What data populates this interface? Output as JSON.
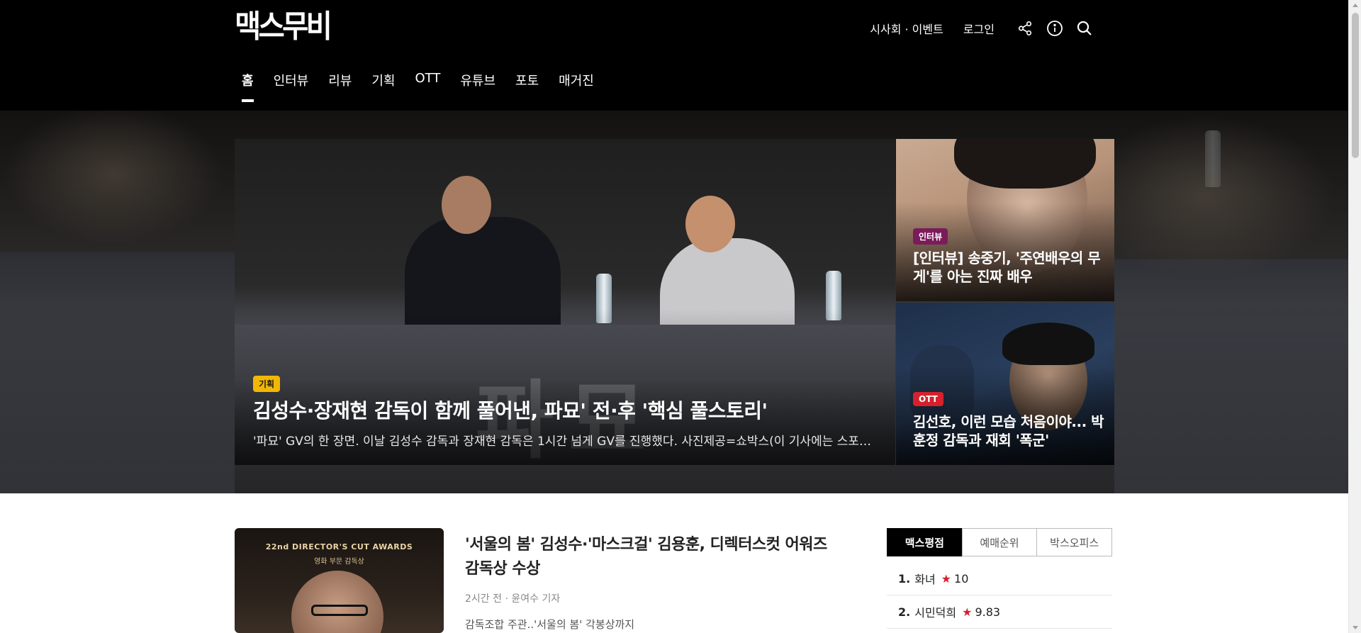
{
  "header": {
    "logo": "맥스무비",
    "util_links": [
      "시사회 · 이벤트",
      "로그인"
    ],
    "icons": [
      "share-icon",
      "info-icon",
      "search-icon"
    ],
    "nav": [
      "홈",
      "인터뷰",
      "리뷰",
      "기획",
      "OTT",
      "유튜브",
      "포토",
      "매거진"
    ],
    "active_nav": "홈"
  },
  "hero": {
    "main": {
      "tag": "기획",
      "title": "김성수·장재현 감독이 함께 풀어낸, 파묘' 전·후 '핵심 풀스토리'",
      "description": "'파묘' GV의 한 장면. 이날 김성수 감독과 장재현 감독은 1시간 넘게 GV를 진행했다. 사진제공=쇼박스(이 기사에는 스포일러가 포함되어 있습니다)",
      "image_text": "파묘"
    },
    "side": [
      {
        "tag": "인터뷰",
        "title": "[인터뷰] 송중기, '주연배우의 무게'를 아는 진짜 배우"
      },
      {
        "tag": "OTT",
        "title": "김선호, 이런 모습 처음이야... 박훈정 감독과 재회 '폭군'"
      }
    ]
  },
  "feature_article": {
    "thumb_title": "22nd DIRECTOR'S CUT AWARDS",
    "thumb_subtitle": "영화 부문 감독상",
    "title": "'서울의 봄' 김성수·'마스크걸' 김용훈, 디렉터스컷 어워즈 감독상 수상",
    "meta": "2시간 전 · 윤여수 기자",
    "summary": "감독조합 주관..'서울의 봄' 각봉상까지"
  },
  "ranking": {
    "tabs": [
      "맥스평점",
      "예매순위",
      "박스오피스"
    ],
    "active_tab": "맥스평점",
    "items": [
      {
        "num": "1.",
        "title": "화녀",
        "score": "10"
      },
      {
        "num": "2.",
        "title": "시민덕희",
        "score": "9.83"
      }
    ]
  },
  "colors": {
    "header_bg": "#000000",
    "tag_planning": "#f2b705",
    "tag_interview": "#7b1b5b",
    "tag_ott": "#d6212c",
    "star": "#d6212c"
  }
}
